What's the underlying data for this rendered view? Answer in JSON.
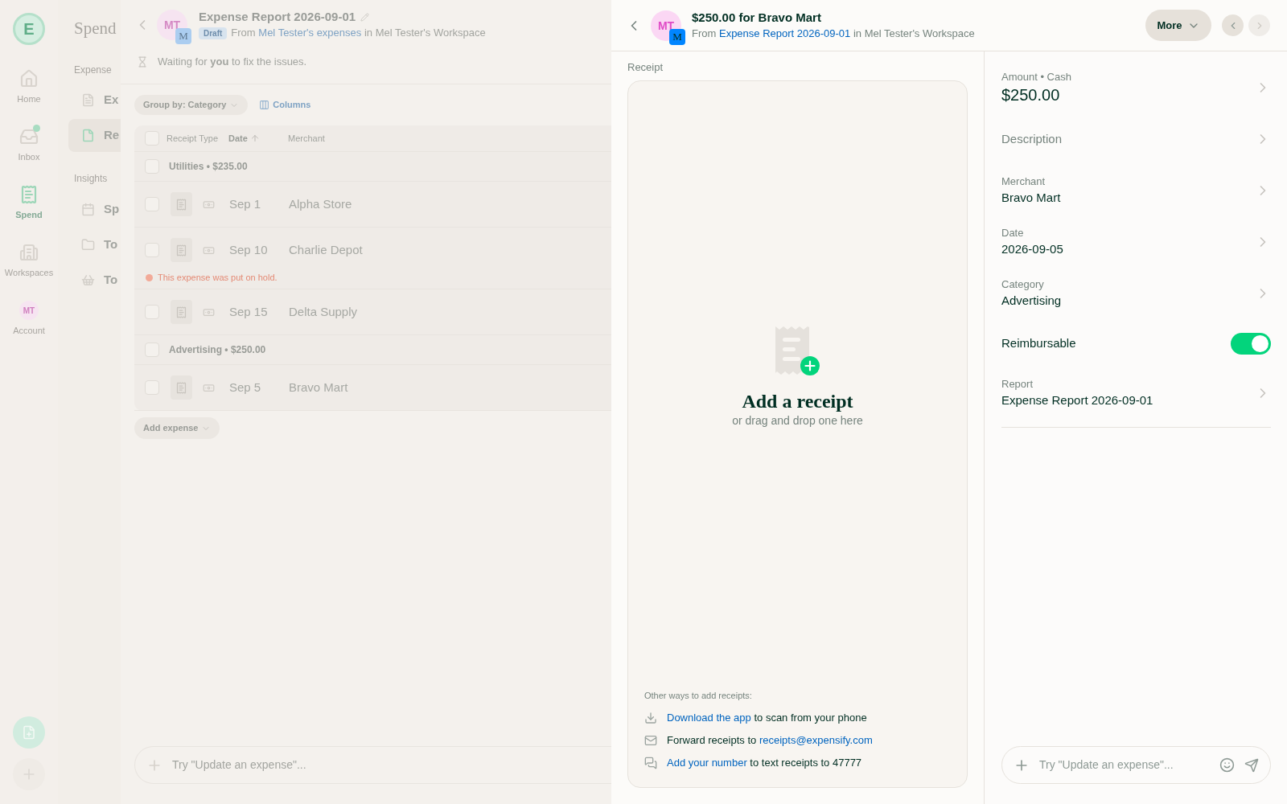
{
  "nav_rail": {
    "logo": "E",
    "items": [
      {
        "kind": "icon",
        "label": "Home",
        "selected": false,
        "unread": false
      },
      {
        "kind": "icon",
        "label": "Inbox",
        "selected": false,
        "unread": true
      },
      {
        "kind": "icon",
        "label": "Spend",
        "selected": true,
        "unread": false
      },
      {
        "kind": "icon",
        "label": "Workspaces",
        "selected": false,
        "unread": false
      },
      {
        "kind": "avatar",
        "avatar": "MT",
        "label": "Account",
        "selected": false,
        "unread": false
      }
    ]
  },
  "sidebar": {
    "title": "Spend",
    "sections": [
      {
        "heading": "Expense",
        "items": [
          {
            "label": "Ex",
            "selected": false
          },
          {
            "label": "Re",
            "selected": true
          }
        ]
      },
      {
        "heading": "Insights",
        "items": [
          {
            "label": "Sp",
            "selected": false
          },
          {
            "label": "To",
            "selected": false
          },
          {
            "label": "To",
            "selected": false
          }
        ]
      }
    ]
  },
  "report": {
    "avatar": {
      "initials": "MT",
      "badge": "M"
    },
    "title": "Expense Report 2026-09-01",
    "status": "Draft",
    "subtitle": {
      "prefix": "From",
      "link": "Mel Tester's expenses",
      "suffix": "in Mel Tester's Workspace"
    },
    "next_step": "Waiting for **you** to fix the issues.",
    "group_by": "Group by: Category",
    "columns_button": "Columns",
    "table": {
      "header_checked": false,
      "columns": [
        {
          "label": "Receipt Type",
          "sorted": false
        },
        {
          "label": "Date",
          "sorted": true
        },
        {
          "label": "Merchant",
          "sorted": false
        }
      ],
      "groups": [
        {
          "title": "Utilities • $235.00",
          "checked": false,
          "rows": [
            {
              "date": "Sep 1",
              "merchant": "Alpha Store",
              "checked": false
            },
            {
              "date": "Sep 10",
              "merchant": "Charlie Depot",
              "checked": false,
              "hold_message": "This expense was put on hold."
            },
            {
              "date": "Sep 15",
              "merchant": "Delta Supply",
              "checked": false
            }
          ]
        },
        {
          "title": "Advertising • $250.00",
          "checked": false,
          "rows": [
            {
              "date": "Sep 5",
              "merchant": "Bravo Mart",
              "checked": false
            }
          ]
        }
      ]
    },
    "add_expense": "Add expense",
    "composer": {
      "placeholder": "Try \"Update an expense\"..."
    }
  },
  "expense": {
    "avatar": {
      "initials": "MT",
      "badge": "M"
    },
    "title": "$250.00 for Bravo Mart",
    "subtitle": {
      "prefix": "From",
      "link": "Expense Report 2026-09-01",
      "suffix": "in Mel Tester's Workspace"
    },
    "more_button": "More",
    "pager": [
      {
        "disabled": false
      },
      {
        "disabled": true
      }
    ],
    "receipt": {
      "label": "Receipt",
      "title": "Add a receipt",
      "subtitle": "or drag and drop one here",
      "other_ways_heading": "Other ways to add receipts:",
      "other_ways": [
        {
          "link": "Download the app",
          "after": "to scan from your phone"
        },
        {
          "before": "Forward receipts to",
          "link": "receipts@expensify.com"
        },
        {
          "link": "Add your number",
          "after": "to text receipts to 47777"
        }
      ]
    },
    "fields": [
      {
        "kind": "amount",
        "label": "Amount • Cash",
        "value": "$250.00"
      },
      {
        "kind": "empty",
        "label": "Description"
      },
      {
        "kind": "text",
        "label": "Merchant",
        "value": "Bravo Mart"
      },
      {
        "kind": "text",
        "label": "Date",
        "value": "2026-09-05"
      },
      {
        "kind": "text",
        "label": "Category",
        "value": "Advertising"
      },
      {
        "kind": "toggle",
        "label": "Reimbursable",
        "on": true
      },
      {
        "kind": "text",
        "label": "Report",
        "value": "Expense Report 2026-09-01"
      }
    ],
    "composer": {
      "placeholder": "Try \"Update an expense\"..."
    }
  }
}
